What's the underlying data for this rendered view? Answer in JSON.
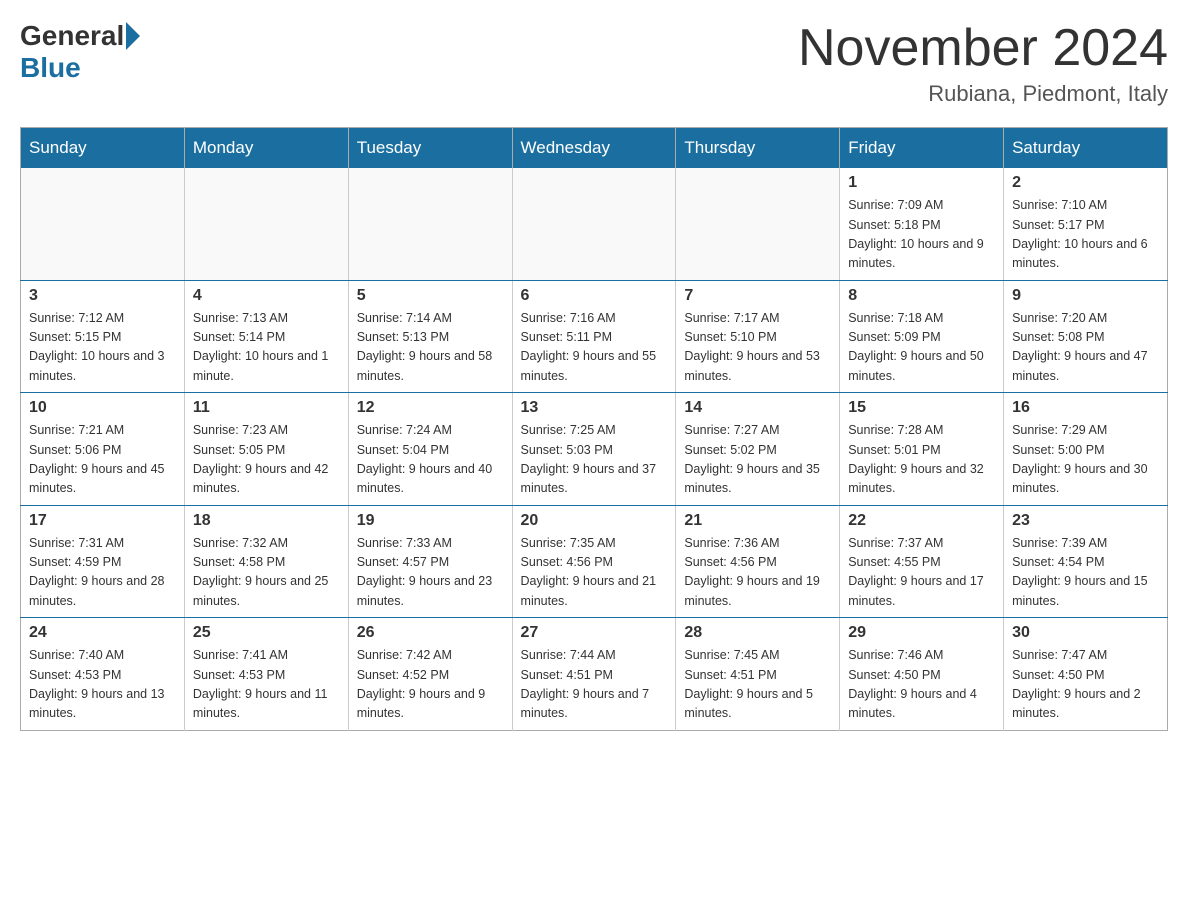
{
  "header": {
    "logo_general": "General",
    "logo_blue": "Blue",
    "month_title": "November 2024",
    "location": "Rubiana, Piedmont, Italy"
  },
  "weekdays": [
    "Sunday",
    "Monday",
    "Tuesday",
    "Wednesday",
    "Thursday",
    "Friday",
    "Saturday"
  ],
  "weeks": [
    [
      {
        "day": "",
        "info": ""
      },
      {
        "day": "",
        "info": ""
      },
      {
        "day": "",
        "info": ""
      },
      {
        "day": "",
        "info": ""
      },
      {
        "day": "",
        "info": ""
      },
      {
        "day": "1",
        "info": "Sunrise: 7:09 AM\nSunset: 5:18 PM\nDaylight: 10 hours and 9 minutes."
      },
      {
        "day": "2",
        "info": "Sunrise: 7:10 AM\nSunset: 5:17 PM\nDaylight: 10 hours and 6 minutes."
      }
    ],
    [
      {
        "day": "3",
        "info": "Sunrise: 7:12 AM\nSunset: 5:15 PM\nDaylight: 10 hours and 3 minutes."
      },
      {
        "day": "4",
        "info": "Sunrise: 7:13 AM\nSunset: 5:14 PM\nDaylight: 10 hours and 1 minute."
      },
      {
        "day": "5",
        "info": "Sunrise: 7:14 AM\nSunset: 5:13 PM\nDaylight: 9 hours and 58 minutes."
      },
      {
        "day": "6",
        "info": "Sunrise: 7:16 AM\nSunset: 5:11 PM\nDaylight: 9 hours and 55 minutes."
      },
      {
        "day": "7",
        "info": "Sunrise: 7:17 AM\nSunset: 5:10 PM\nDaylight: 9 hours and 53 minutes."
      },
      {
        "day": "8",
        "info": "Sunrise: 7:18 AM\nSunset: 5:09 PM\nDaylight: 9 hours and 50 minutes."
      },
      {
        "day": "9",
        "info": "Sunrise: 7:20 AM\nSunset: 5:08 PM\nDaylight: 9 hours and 47 minutes."
      }
    ],
    [
      {
        "day": "10",
        "info": "Sunrise: 7:21 AM\nSunset: 5:06 PM\nDaylight: 9 hours and 45 minutes."
      },
      {
        "day": "11",
        "info": "Sunrise: 7:23 AM\nSunset: 5:05 PM\nDaylight: 9 hours and 42 minutes."
      },
      {
        "day": "12",
        "info": "Sunrise: 7:24 AM\nSunset: 5:04 PM\nDaylight: 9 hours and 40 minutes."
      },
      {
        "day": "13",
        "info": "Sunrise: 7:25 AM\nSunset: 5:03 PM\nDaylight: 9 hours and 37 minutes."
      },
      {
        "day": "14",
        "info": "Sunrise: 7:27 AM\nSunset: 5:02 PM\nDaylight: 9 hours and 35 minutes."
      },
      {
        "day": "15",
        "info": "Sunrise: 7:28 AM\nSunset: 5:01 PM\nDaylight: 9 hours and 32 minutes."
      },
      {
        "day": "16",
        "info": "Sunrise: 7:29 AM\nSunset: 5:00 PM\nDaylight: 9 hours and 30 minutes."
      }
    ],
    [
      {
        "day": "17",
        "info": "Sunrise: 7:31 AM\nSunset: 4:59 PM\nDaylight: 9 hours and 28 minutes."
      },
      {
        "day": "18",
        "info": "Sunrise: 7:32 AM\nSunset: 4:58 PM\nDaylight: 9 hours and 25 minutes."
      },
      {
        "day": "19",
        "info": "Sunrise: 7:33 AM\nSunset: 4:57 PM\nDaylight: 9 hours and 23 minutes."
      },
      {
        "day": "20",
        "info": "Sunrise: 7:35 AM\nSunset: 4:56 PM\nDaylight: 9 hours and 21 minutes."
      },
      {
        "day": "21",
        "info": "Sunrise: 7:36 AM\nSunset: 4:56 PM\nDaylight: 9 hours and 19 minutes."
      },
      {
        "day": "22",
        "info": "Sunrise: 7:37 AM\nSunset: 4:55 PM\nDaylight: 9 hours and 17 minutes."
      },
      {
        "day": "23",
        "info": "Sunrise: 7:39 AM\nSunset: 4:54 PM\nDaylight: 9 hours and 15 minutes."
      }
    ],
    [
      {
        "day": "24",
        "info": "Sunrise: 7:40 AM\nSunset: 4:53 PM\nDaylight: 9 hours and 13 minutes."
      },
      {
        "day": "25",
        "info": "Sunrise: 7:41 AM\nSunset: 4:53 PM\nDaylight: 9 hours and 11 minutes."
      },
      {
        "day": "26",
        "info": "Sunrise: 7:42 AM\nSunset: 4:52 PM\nDaylight: 9 hours and 9 minutes."
      },
      {
        "day": "27",
        "info": "Sunrise: 7:44 AM\nSunset: 4:51 PM\nDaylight: 9 hours and 7 minutes."
      },
      {
        "day": "28",
        "info": "Sunrise: 7:45 AM\nSunset: 4:51 PM\nDaylight: 9 hours and 5 minutes."
      },
      {
        "day": "29",
        "info": "Sunrise: 7:46 AM\nSunset: 4:50 PM\nDaylight: 9 hours and 4 minutes."
      },
      {
        "day": "30",
        "info": "Sunrise: 7:47 AM\nSunset: 4:50 PM\nDaylight: 9 hours and 2 minutes."
      }
    ]
  ]
}
